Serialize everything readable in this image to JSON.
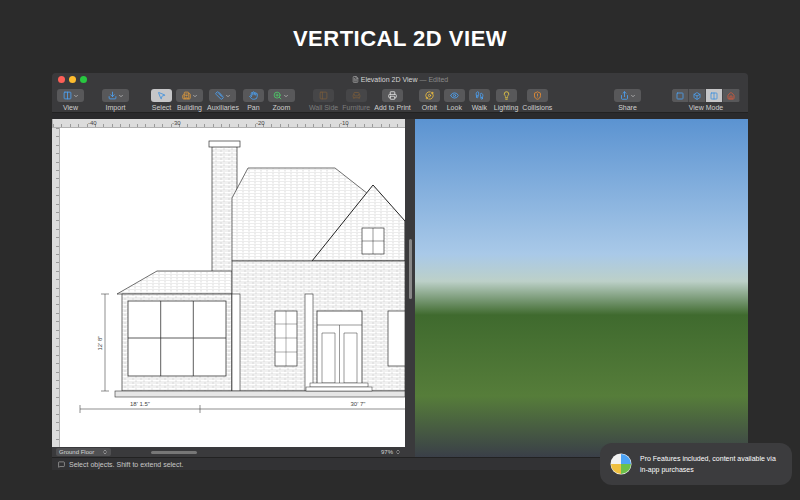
{
  "headline": "VERTICAL 2D VIEW",
  "window": {
    "title": "Elevation 2D View",
    "subtitle": "— Edited"
  },
  "toolbar": {
    "groups": [
      {
        "items": [
          {
            "label": "View",
            "has_menu": true,
            "selected": false,
            "disabled": false,
            "color": "#4da3f5"
          }
        ]
      },
      {
        "items": [
          {
            "label": "Import",
            "has_menu": true,
            "selected": false,
            "disabled": false,
            "color": "#4da3f5"
          }
        ]
      },
      {
        "items": [
          {
            "label": "Select",
            "has_menu": false,
            "selected": true,
            "disabled": false,
            "color": "#3a8fe0"
          },
          {
            "label": "Building",
            "has_menu": true,
            "selected": false,
            "disabled": false,
            "color": "#e09a3c"
          },
          {
            "label": "Auxiliaries",
            "has_menu": true,
            "selected": false,
            "disabled": false,
            "color": "#4da3f5"
          },
          {
            "label": "Pan",
            "has_menu": false,
            "selected": false,
            "disabled": false,
            "color": "#4da3f5"
          },
          {
            "label": "Zoom",
            "has_menu": true,
            "selected": false,
            "disabled": false,
            "color": "#4ecf6a"
          }
        ]
      },
      {
        "items": [
          {
            "label": "Wall Side",
            "has_menu": false,
            "selected": false,
            "disabled": true,
            "color": "#d08a3a"
          },
          {
            "label": "Furniture",
            "has_menu": false,
            "selected": false,
            "disabled": true,
            "color": "#d08a3a"
          },
          {
            "label": "Add to Print",
            "has_menu": false,
            "selected": false,
            "disabled": false,
            "color": "#e6e6e6"
          }
        ]
      },
      {
        "items": [
          {
            "label": "Orbit",
            "has_menu": false,
            "selected": false,
            "disabled": false,
            "color": "#f0c040"
          },
          {
            "label": "Look",
            "has_menu": false,
            "selected": false,
            "disabled": false,
            "color": "#4da3f5"
          },
          {
            "label": "Walk",
            "has_menu": false,
            "selected": false,
            "disabled": false,
            "color": "#4da3f5"
          },
          {
            "label": "Lighting",
            "has_menu": false,
            "selected": false,
            "disabled": false,
            "color": "#f0d040"
          },
          {
            "label": "Collisions",
            "has_menu": false,
            "selected": false,
            "disabled": false,
            "color": "#f09030"
          }
        ]
      },
      {
        "items": [
          {
            "label": "Share",
            "has_menu": true,
            "selected": false,
            "disabled": false,
            "color": "#4da3f5"
          }
        ]
      }
    ],
    "view_mode": {
      "label": "View Mode",
      "segments": [
        {
          "selected": false,
          "color": "#4da3f5"
        },
        {
          "selected": false,
          "color": "#4da3f5"
        },
        {
          "selected": true,
          "color": "#3a8fe0"
        },
        {
          "selected": false,
          "color": "#e05a3a"
        }
      ]
    }
  },
  "ruler": {
    "ticks": [
      "-40",
      "-30",
      "-20",
      "-10"
    ]
  },
  "drawing": {
    "dimensions": {
      "height": "12' 8\"",
      "left_width": "18' 1.5\"",
      "right_width": "30' 7\""
    }
  },
  "floor_selector": {
    "value": "Ground Floor"
  },
  "zoom": {
    "value": "97%"
  },
  "status_bar": {
    "text": "Select objects. Shift to extend select."
  },
  "badge": {
    "lines": [
      "Pro Features included, content available via",
      "in-app purchases"
    ]
  }
}
